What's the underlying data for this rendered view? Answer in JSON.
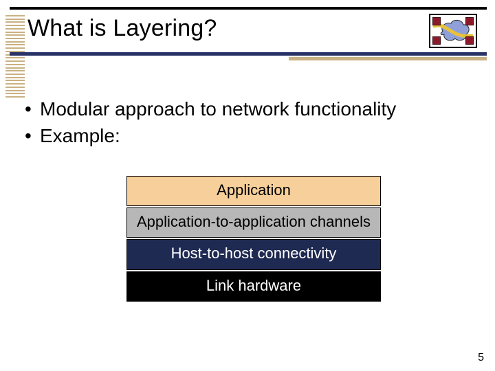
{
  "title": "What is Layering?",
  "bullets": [
    "Modular approach to network functionality",
    "Example:"
  ],
  "layers": [
    {
      "label": "Application",
      "class": "l-app"
    },
    {
      "label": "Application-to-application channels",
      "class": "l-chan"
    },
    {
      "label": "Host-to-host connectivity",
      "class": "l-host"
    },
    {
      "label": "Link hardware",
      "class": "l-link"
    }
  ],
  "icon": {
    "squares": [
      "tl",
      "tr",
      "bl",
      "br"
    ],
    "cloud_fill": "#8fa0d8",
    "ribbon_fill": "#e7c23a"
  },
  "page_number": "5"
}
